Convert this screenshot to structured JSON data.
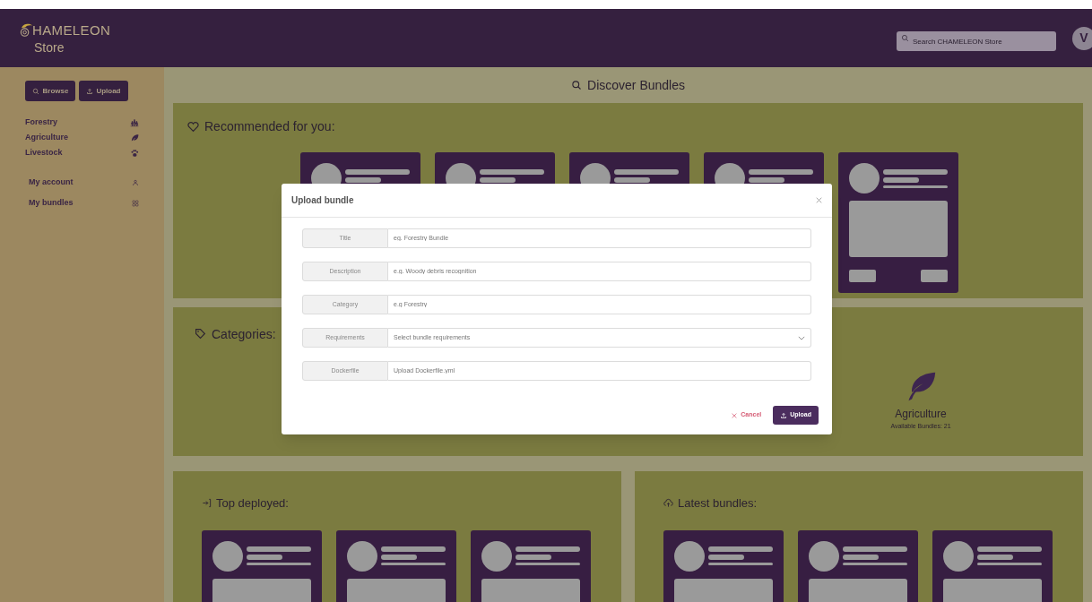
{
  "header": {
    "logo_text": "HAMELEON",
    "logo_subtext": "Store",
    "search": {
      "placeholder": "Search CHAMELEON Store"
    },
    "avatar": "V"
  },
  "sidebar": {
    "buttons": [
      {
        "label": "Browse"
      },
      {
        "label": "Upload"
      }
    ],
    "categories": [
      {
        "label": "Forestry"
      },
      {
        "label": "Agriculture"
      },
      {
        "label": "Livestock"
      }
    ],
    "account": [
      {
        "label": "My account"
      },
      {
        "label": "My bundles"
      }
    ]
  },
  "main": {
    "title": "Discover Bundles",
    "recommended": {
      "title": "Recommended for you:"
    },
    "categories": {
      "title": "Categories:",
      "items": [
        {
          "name": "Agriculture",
          "count": "Available Bundles: 21"
        }
      ]
    },
    "top_deployed": {
      "title": "Top deployed:"
    },
    "latest": {
      "title": "Latest bundles:"
    }
  },
  "modal": {
    "title": "Upload bundle",
    "fields": [
      {
        "label": "Title",
        "placeholder": "eg. Forestry Bundle",
        "kind": "text"
      },
      {
        "label": "Description",
        "placeholder": "e.g. Woody debris recognition",
        "kind": "text"
      },
      {
        "label": "Category",
        "placeholder": "e.g Forestry",
        "kind": "text"
      },
      {
        "label": "Requirements",
        "placeholder": "Select bundle requirements",
        "kind": "select"
      },
      {
        "label": "Dockerfile",
        "placeholder": "Upload Dockerfile.yml",
        "kind": "text"
      }
    ],
    "cancel": "Cancel",
    "submit": "Upload"
  }
}
